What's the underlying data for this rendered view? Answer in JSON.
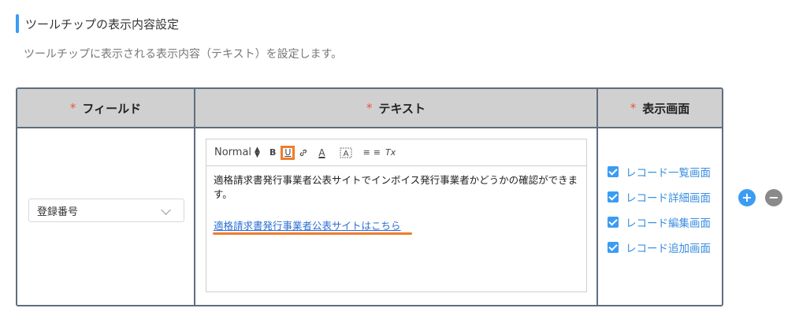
{
  "section": {
    "title": "ツールチップの表示内容設定",
    "description": "ツールチップに表示される表示内容（テキスト）を設定します。"
  },
  "table": {
    "required_mark": "*",
    "headers": [
      "フィールド",
      "テキスト",
      "表示画面"
    ]
  },
  "row": {
    "field_select_value": "登録番号",
    "editor": {
      "toolbar": {
        "format_label": "Normal",
        "bold_label": "B",
        "underline_label": "U",
        "link_icon": "link-icon",
        "color_label": "A",
        "background_label": "A",
        "list_label": "≡",
        "bullet_label": "≡",
        "clear_label": "Tx"
      },
      "body_text": "適格請求書発行事業者公表サイトでインボイス発行事業者かどうかの確認ができます。",
      "link_text": "適格請求書発行事業者公表サイトはこちら"
    },
    "screens": [
      "レコード一覧画面",
      "レコード詳細画面",
      "レコード編集画面",
      "レコード追加画面"
    ]
  },
  "colors": {
    "accent": "#3b9cf3",
    "highlight": "#f07c2a",
    "required": "#e8553f",
    "link": "#2b6fd4"
  },
  "actions": {
    "add_label": "+",
    "remove_label": "−"
  }
}
